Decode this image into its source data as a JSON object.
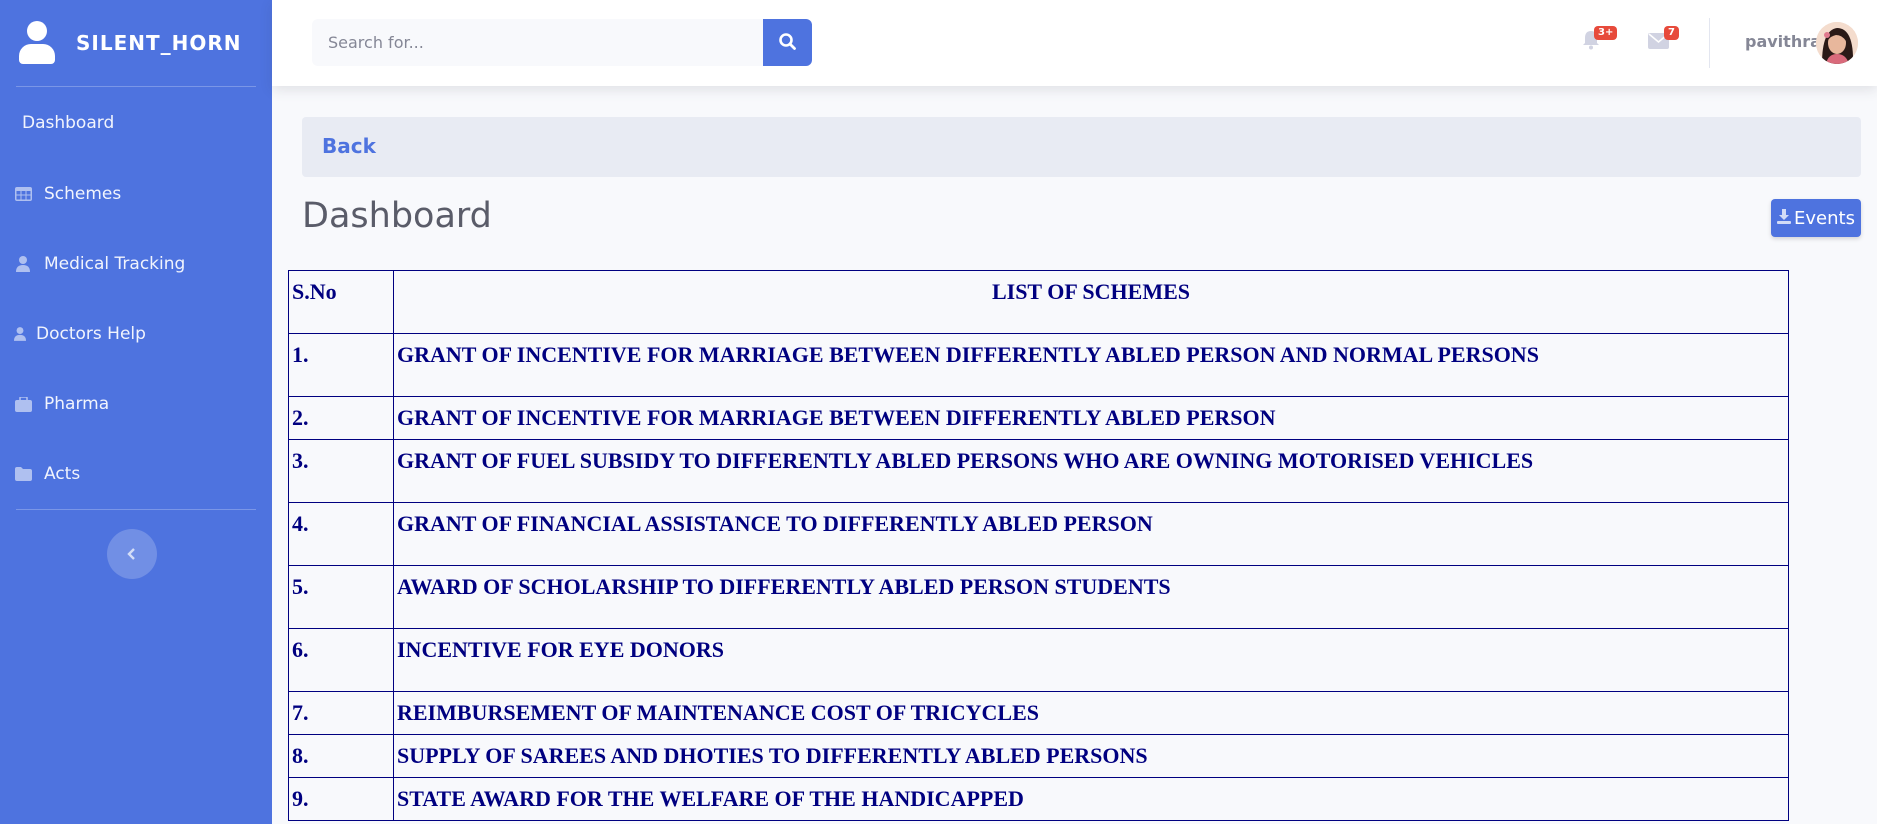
{
  "brand": {
    "name": "SILENT_HORN",
    "icon": "user-icon"
  },
  "sidebar": {
    "items": [
      {
        "label": "Dashboard",
        "icon": ""
      },
      {
        "label": "Schemes",
        "icon": "table-icon"
      },
      {
        "label": "Medical Tracking",
        "icon": "user-icon"
      },
      {
        "label": "Doctors Help",
        "icon": "user-icon"
      },
      {
        "label": "Pharma",
        "icon": "briefcase-icon"
      },
      {
        "label": "Acts",
        "icon": "folder-icon"
      }
    ],
    "toggle_icon": "chevron-left-icon"
  },
  "topbar": {
    "search_placeholder": "Search for...",
    "alerts_badge": "3+",
    "messages_badge": "7",
    "username": "pavithra"
  },
  "content": {
    "back_label": "Back",
    "page_title": "Dashboard",
    "events_label": "Events"
  },
  "table": {
    "headers": [
      "S.No",
      "LIST OF SCHEMES"
    ],
    "rows": [
      {
        "sno": "1.",
        "scheme": "GRANT OF INCENTIVE FOR MARRIAGE BETWEEN DIFFERENTLY ABLED PERSON AND NORMAL PERSONS"
      },
      {
        "sno": "2.",
        "scheme": "GRANT OF INCENTIVE FOR MARRIAGE BETWEEN DIFFERENTLY ABLED PERSON"
      },
      {
        "sno": "3.",
        "scheme": "GRANT OF FUEL SUBSIDY TO DIFFERENTLY ABLED PERSONS WHO ARE OWNING MOTORISED VEHICLES"
      },
      {
        "sno": "4.",
        "scheme": "GRANT OF FINANCIAL ASSISTANCE TO DIFFERENTLY ABLED PERSON"
      },
      {
        "sno": "5.",
        "scheme": "AWARD OF SCHOLARSHIP TO DIFFERENTLY ABLED PERSON STUDENTS"
      },
      {
        "sno": "6.",
        "scheme": "INCENTIVE FOR EYE DONORS"
      },
      {
        "sno": "7.",
        "scheme": "REIMBURSEMENT OF MAINTENANCE COST OF TRICYCLES"
      },
      {
        "sno": "8.",
        "scheme": "SUPPLY OF SAREES AND DHOTIES TO DIFFERENTLY ABLED PERSONS"
      },
      {
        "sno": "9.",
        "scheme": "STATE AWARD FOR THE WELFARE OF THE HANDICAPPED"
      }
    ]
  },
  "colors": {
    "primary": "#4e73df",
    "table_text": "#000080",
    "badge": "#e74a3b"
  }
}
